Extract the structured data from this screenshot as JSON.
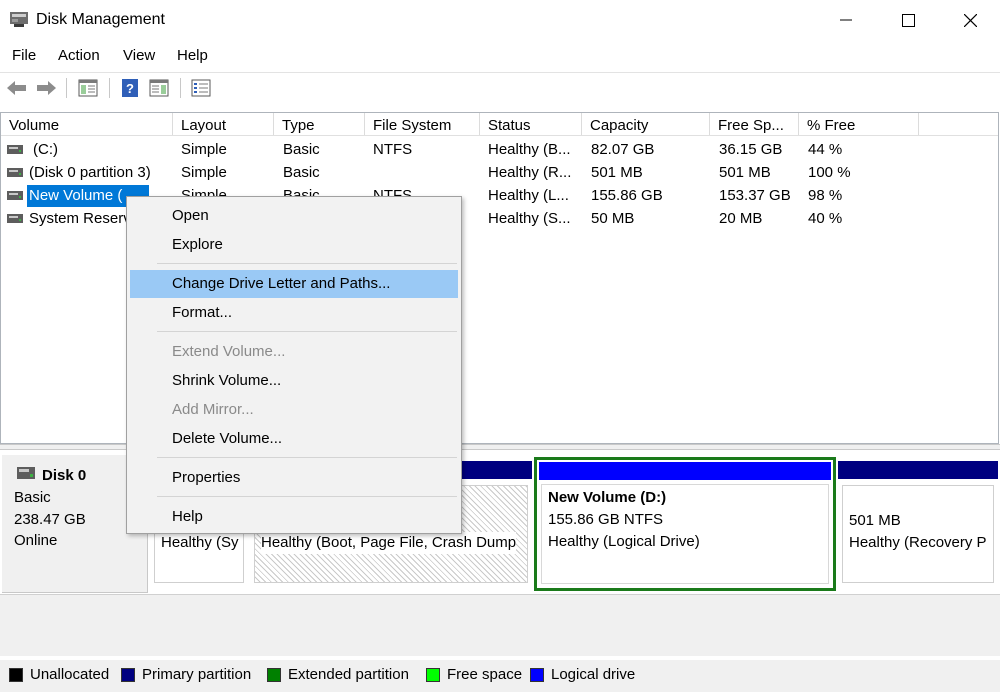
{
  "window": {
    "title": "Disk Management",
    "controls": {
      "minimize": "—",
      "maximize": "☐",
      "close": "✕"
    }
  },
  "menu": [
    "File",
    "Action",
    "View",
    "Help"
  ],
  "toolbar": {
    "icons": [
      "back-arrow-icon",
      "forward-arrow-icon",
      "show-hide-console-tree-icon",
      "help-icon",
      "properties-icon",
      "list-view-icon"
    ]
  },
  "volume_list": {
    "columns": [
      "Volume",
      "Layout",
      "Type",
      "File System",
      "Status",
      "Capacity",
      "Free Sp...",
      "% Free"
    ],
    "rows": [
      {
        "volume": "(C:)",
        "layout": "Simple",
        "type": "Basic",
        "fs": "NTFS",
        "status": "Healthy (B...",
        "capacity": "82.07 GB",
        "free": "36.15 GB",
        "pct": "44 %"
      },
      {
        "volume": "(Disk 0 partition 3)",
        "layout": "Simple",
        "type": "Basic",
        "fs": "",
        "status": "Healthy (R...",
        "capacity": "501 MB",
        "free": "501 MB",
        "pct": "100 %"
      },
      {
        "volume": "New Volume (",
        "layout": "Simple",
        "type": "Basic",
        "fs": "NTFS",
        "status": "Healthy (L...",
        "capacity": "155.86 GB",
        "free": "153.37 GB",
        "pct": "98 %"
      },
      {
        "volume": "System Reserv",
        "layout": "",
        "type": "",
        "fs": "",
        "status": "Healthy (S...",
        "capacity": "50 MB",
        "free": "20 MB",
        "pct": "40 %"
      }
    ],
    "selected_row_index": 2,
    "selection_color": "#0078d7"
  },
  "context_menu": {
    "items": [
      {
        "label": "Open",
        "disabled": false
      },
      {
        "label": "Explore",
        "disabled": false
      },
      {
        "label": "Change Drive Letter and Paths...",
        "disabled": false,
        "highlighted": true
      },
      {
        "label": "Format...",
        "disabled": false
      },
      {
        "label": "Extend Volume...",
        "disabled": true
      },
      {
        "label": "Shrink Volume...",
        "disabled": false
      },
      {
        "label": "Add Mirror...",
        "disabled": true
      },
      {
        "label": "Delete Volume...",
        "disabled": false
      },
      {
        "label": "Properties",
        "disabled": false
      },
      {
        "label": "Help",
        "disabled": false
      }
    ]
  },
  "disk": {
    "name": "Disk 0",
    "type": "Basic",
    "size": "238.47 GB",
    "state": "Online",
    "partitions": [
      {
        "id": "system-reserved",
        "line3": "Healthy (Sy"
      },
      {
        "id": "c",
        "line3": "Healthy (Boot, Page File, Crash Dump"
      },
      {
        "id": "new-volume",
        "title": "New Volume  (D:)",
        "line2": "155.86 GB NTFS",
        "line3": "Healthy (Logical Drive)"
      },
      {
        "id": "recovery",
        "line2": "501 MB",
        "line3": "Healthy (Recovery P"
      }
    ]
  },
  "legend": [
    {
      "label": "Unallocated",
      "color": "#000000"
    },
    {
      "label": "Primary partition",
      "color": "#000080"
    },
    {
      "label": "Extended partition",
      "color": "#008000"
    },
    {
      "label": "Free space",
      "color": "#00ff00"
    },
    {
      "label": "Logical drive",
      "color": "#0000ff"
    }
  ]
}
